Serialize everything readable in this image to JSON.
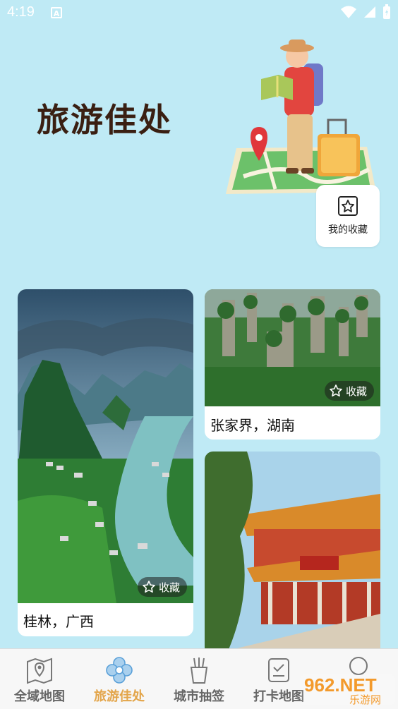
{
  "status_bar": {
    "time": "4:19",
    "notification_letter": "A"
  },
  "header": {
    "title": "旅游佳处"
  },
  "favorites": {
    "label": "我的收藏"
  },
  "cards": [
    {
      "caption": "桂林，广西",
      "save_label": "收藏"
    },
    {
      "caption": "张家界，湖南",
      "save_label": "收藏"
    },
    {
      "caption": ""
    }
  ],
  "tabs": [
    {
      "label": "全域地图",
      "icon": "map-icon",
      "active": false
    },
    {
      "label": "旅游佳处",
      "icon": "flower-icon",
      "active": true
    },
    {
      "label": "城市抽签",
      "icon": "lots-cup-icon",
      "active": false
    },
    {
      "label": "打卡地图",
      "icon": "checkin-icon",
      "active": false
    },
    {
      "label": "",
      "icon": "profile-icon",
      "active": false
    }
  ],
  "watermark": {
    "text": "962.NET",
    "subtext": "乐游网"
  },
  "colors": {
    "background": "#bfeaf5",
    "active_tab": "#e3a54a",
    "title": "#3a1f12"
  }
}
